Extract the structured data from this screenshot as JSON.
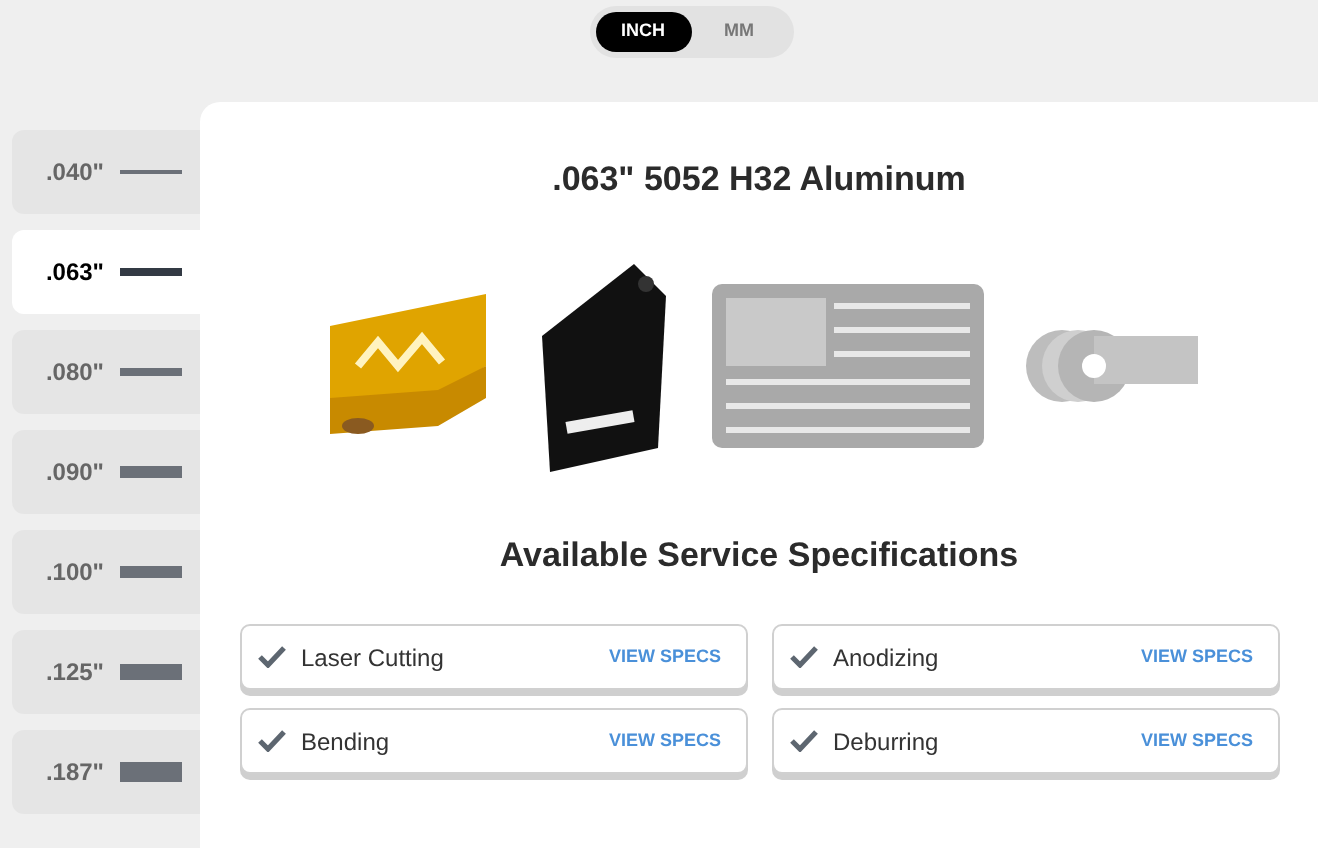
{
  "unit_toggle": [
    {
      "label": "INCH",
      "selected": true
    },
    {
      "label": "MM",
      "selected": false
    }
  ],
  "thickness_tabs": [
    {
      "label": ".040\"",
      "selected": false
    },
    {
      "label": ".063\"",
      "selected": true
    },
    {
      "label": ".080\"",
      "selected": false
    },
    {
      "label": ".090\"",
      "selected": false
    },
    {
      "label": ".100\"",
      "selected": false
    },
    {
      "label": ".125\"",
      "selected": false
    },
    {
      "label": ".187\"",
      "selected": false
    }
  ],
  "material_title": ".063\" 5052 H32 Aluminum",
  "services_heading": "Available Service Specifications",
  "services": [
    {
      "name": "Laser Cutting",
      "link": "VIEW SPECS"
    },
    {
      "name": "Anodizing",
      "link": "VIEW SPECS"
    },
    {
      "name": "Bending",
      "link": "VIEW SPECS"
    },
    {
      "name": "Deburring",
      "link": "VIEW SPECS"
    }
  ]
}
